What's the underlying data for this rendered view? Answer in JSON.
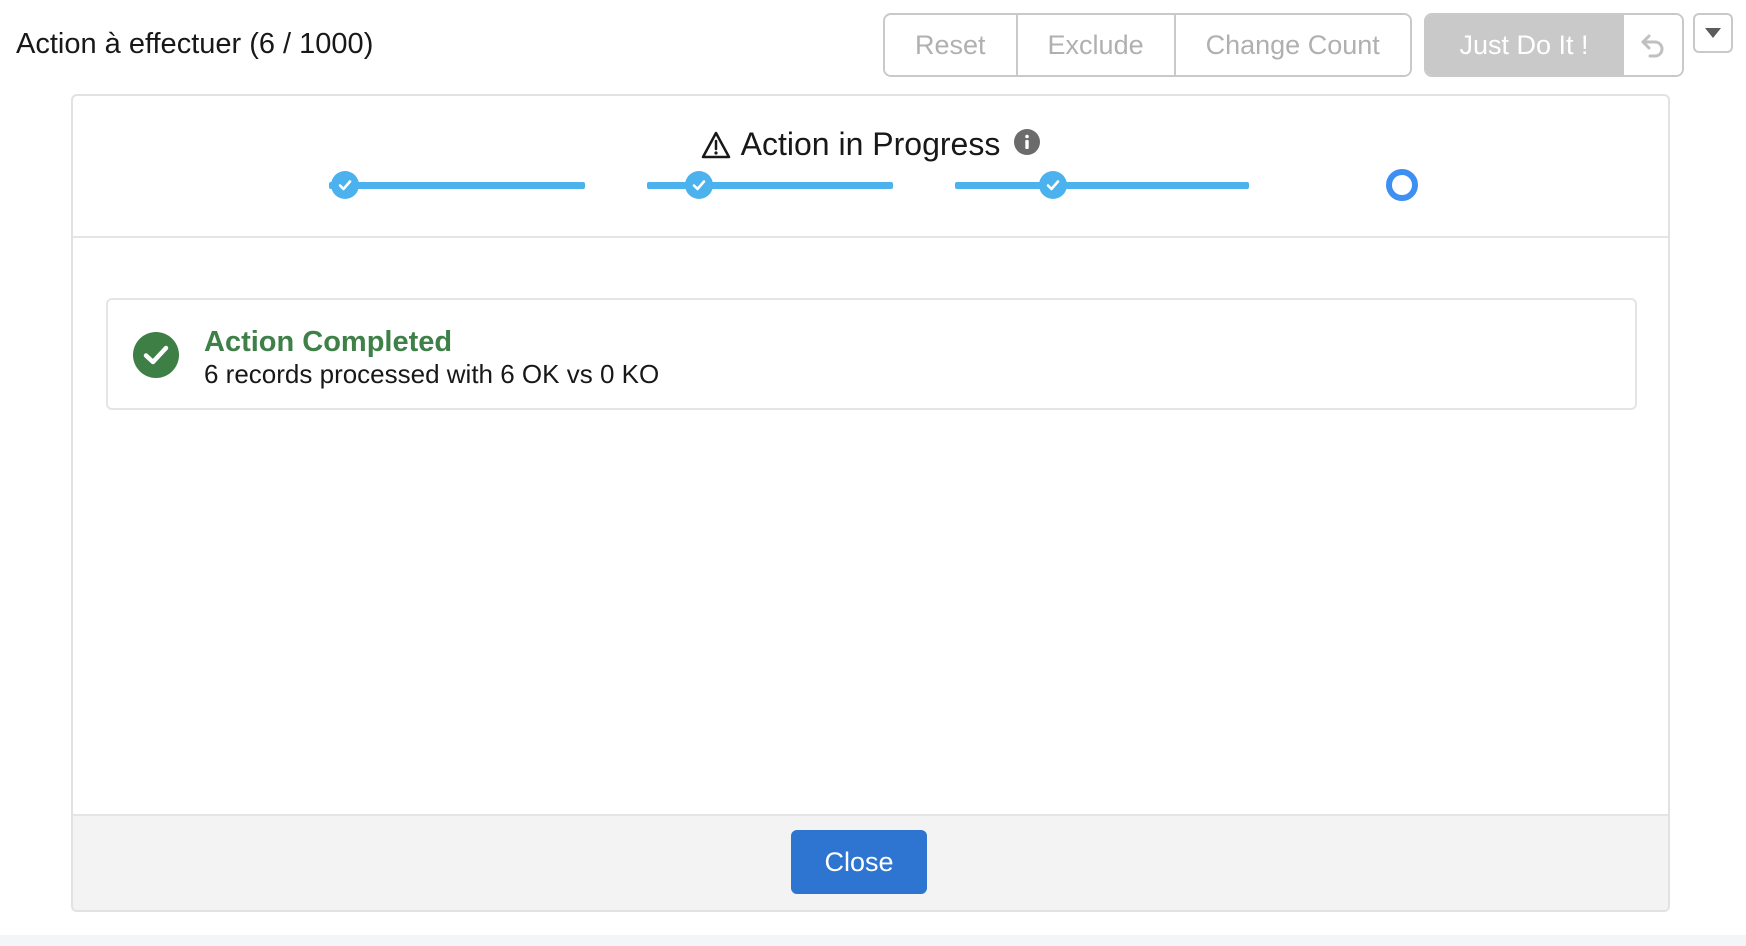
{
  "header": {
    "title": "Action à effectuer (6 / 1000)",
    "buttons": {
      "reset": "Reset",
      "exclude": "Exclude",
      "change_count": "Change Count",
      "just_do_it": "Just Do It !"
    },
    "icons": {
      "undo": "undo-icon",
      "menu": "chevron-down-icon"
    }
  },
  "modal": {
    "title": "Action in Progress",
    "icons": {
      "warning": "warning-icon",
      "info": "info-icon"
    },
    "progress": {
      "total_steps": 4,
      "completed_steps": 3,
      "current_step": 4
    },
    "notice": {
      "status": "success",
      "title": "Action Completed",
      "message": "6 records processed with 6 OK vs 0 KO"
    },
    "footer": {
      "close_label": "Close"
    }
  },
  "colors": {
    "progress": "#4bb2ee",
    "current_step": "#3d8ff1",
    "success": "#3e8048",
    "brand": "#2e74d1",
    "disabled": "#c9c9c9"
  }
}
